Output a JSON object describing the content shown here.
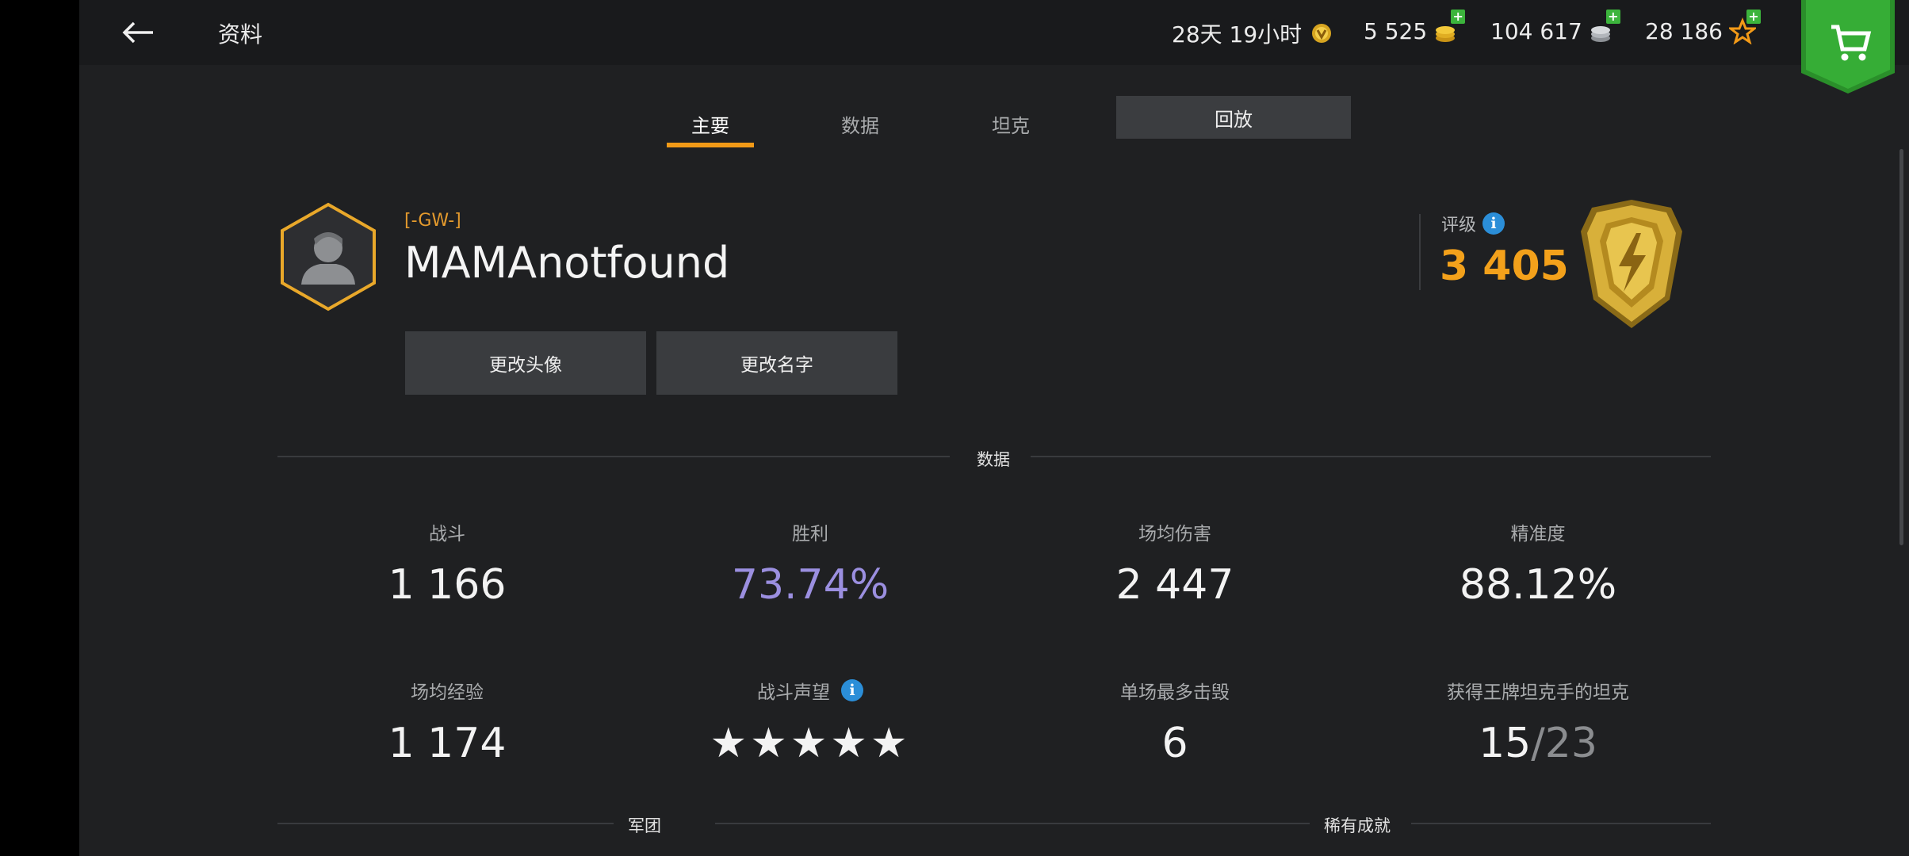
{
  "header": {
    "title": "资料",
    "timer": "28天 19小时",
    "gold": "5 525",
    "credits": "104 617",
    "free_xp": "28 186"
  },
  "tabs": [
    {
      "label": "主要",
      "active": true
    },
    {
      "label": "数据",
      "active": false
    },
    {
      "label": "坦克",
      "active": false
    },
    {
      "label": "回放",
      "active": false
    }
  ],
  "profile": {
    "clan_tag": "[-GW-]",
    "name": "MAMAnotfound",
    "change_avatar": "更改头像",
    "change_name": "更改名字",
    "rating_label": "评级",
    "rating_value": "3 405"
  },
  "sections": {
    "stats_title": "数据",
    "clan_title": "军团",
    "rare_title": "稀有成就"
  },
  "stats": [
    {
      "label": "战斗",
      "value": "1 166"
    },
    {
      "label": "胜利",
      "value": "73.74%"
    },
    {
      "label": "场均伤害",
      "value": "2 447"
    },
    {
      "label": "精准度",
      "value": "88.12%"
    },
    {
      "label": "场均经验",
      "value": "1 174"
    },
    {
      "label": "战斗声望",
      "value": "★★★★★",
      "stars": 5
    },
    {
      "label": "单场最多击毁",
      "value": "6"
    },
    {
      "label": "获得王牌坦克手的坦克",
      "value": "15",
      "total": "/23"
    }
  ],
  "colors": {
    "accent": "#f29a17",
    "win_rate": "#9b8fe0",
    "rating": "#f3a11b",
    "shop": "#2fa32f"
  }
}
